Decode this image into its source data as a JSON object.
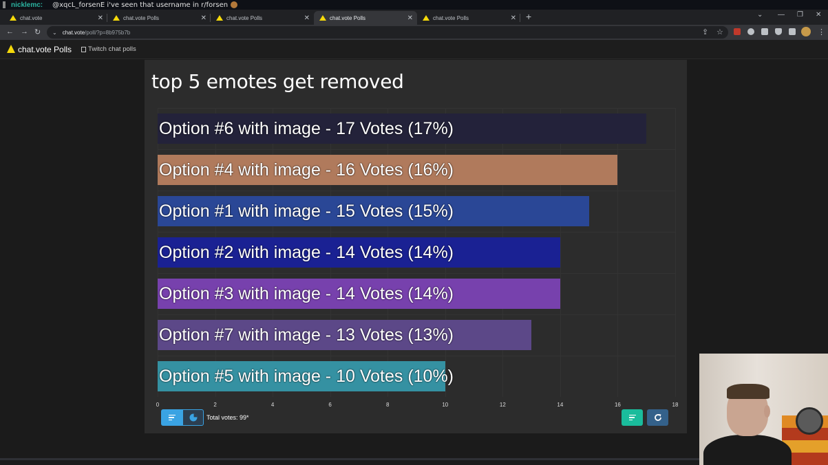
{
  "stream_chat": {
    "username": "nicklemc:",
    "message": "@xqcL_forsenE i've seen that username in r/forsen"
  },
  "browser": {
    "tabs": [
      {
        "label": "chat.vote",
        "active": false
      },
      {
        "label": "chat.vote Polls",
        "active": false
      },
      {
        "label": "chat.vote Polls",
        "active": false
      },
      {
        "label": "chat.vote Polls",
        "active": true
      },
      {
        "label": "chat.vote Polls",
        "active": false
      }
    ],
    "url_host": "chat.vote",
    "url_path": "/poll/?p=8b975b7b"
  },
  "site": {
    "name": "chat.vote Polls",
    "nav_link": "Twitch chat polls"
  },
  "poll": {
    "title": "top 5 emotes get removed",
    "total_votes": "Total votes: 99*"
  },
  "chart_data": {
    "type": "bar",
    "orientation": "horizontal",
    "xlim": [
      0,
      18
    ],
    "ticks": [
      "0",
      "2",
      "4",
      "6",
      "8",
      "10",
      "12",
      "14",
      "16",
      "18"
    ],
    "bars": [
      {
        "label": "Option #6 with image - 17 Votes (17%)",
        "value": 17,
        "color": "#23223a"
      },
      {
        "label": "Option #4 with image - 16 Votes (16%)",
        "value": 16,
        "color": "#b07a5c"
      },
      {
        "label": "Option #1 with image - 15 Votes (15%)",
        "value": 15,
        "color": "#2a4796"
      },
      {
        "label": "Option #2 with image - 14 Votes (14%)",
        "value": 14,
        "color": "#1a2193"
      },
      {
        "label": "Option #3 with image - 14 Votes (14%)",
        "value": 14,
        "color": "#7741ad"
      },
      {
        "label": "Option #7 with image - 13 Votes (13%)",
        "value": 13,
        "color": "#5c4888"
      },
      {
        "label": "Option #5 with image - 10 Votes (10%)",
        "value": 10,
        "color": "#3591a2"
      }
    ]
  }
}
